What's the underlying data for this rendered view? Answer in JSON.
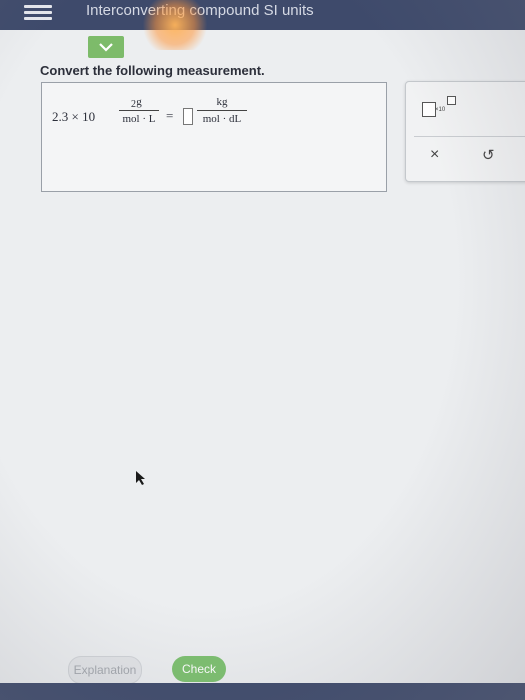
{
  "header": {
    "title": "Interconverting compound SI units"
  },
  "question": {
    "instruction": "Convert the following measurement.",
    "coefficient": "2.3 × 10",
    "exponent": "2",
    "from_unit": {
      "numerator": "g",
      "denominator": "mol · L"
    },
    "equals": "=",
    "answer_value": "",
    "to_unit": {
      "numerator": "kg",
      "denominator": "mol · dL"
    }
  },
  "tools": {
    "x10_label": "×10",
    "close_symbol": "×",
    "undo_symbol": "↺"
  },
  "buttons": {
    "explanation": "Explanation",
    "check": "Check"
  },
  "icons": [
    "menu-icon",
    "chevron-down-icon",
    "x10-icon",
    "close-icon",
    "undo-icon",
    "cursor-arrow-icon"
  ],
  "colors": {
    "topbar": "#3e4a6b",
    "accent_green": "#7cc06f"
  }
}
